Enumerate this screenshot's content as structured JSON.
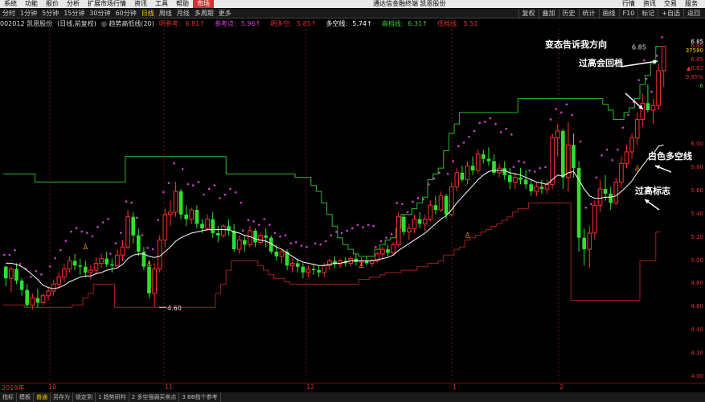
{
  "menu": {
    "items": [
      "系统",
      "功能",
      "报价",
      "分析",
      "扩展市场行情",
      "资讯",
      "工具",
      "帮助",
      "市场"
    ],
    "app_title": "通达信金融终端 凯恩股份",
    "right_items": [
      "行情",
      "资讯",
      "交易",
      "服务"
    ]
  },
  "toolbar": {
    "periods": [
      "分时",
      "1分钟",
      "5分钟",
      "15分钟",
      "30分钟",
      "60分钟",
      "日线",
      "周线",
      "月线",
      "多周期",
      "更多"
    ],
    "right_items": [
      "复权",
      "叠加",
      "历史",
      "统计",
      "画线",
      "F10",
      "标记",
      "+自选",
      "返回"
    ]
  },
  "legend": {
    "code_name": "002012 凯恩股份",
    "mode": "(日线,前复权)",
    "indicator": "◎ 趋势高低线(20)",
    "items": [
      {
        "label": "明参考:",
        "value": "6.81↑",
        "color": "#e03030"
      },
      {
        "label": "参考点:",
        "value": "5.96↑",
        "color": "#e040e0"
      },
      {
        "label": "明多空:",
        "value": "5.85↑",
        "color": "#e03030"
      },
      {
        "label": "多空线:",
        "value": "5.74↑",
        "color": "#ffffff"
      },
      {
        "label": "高档线:",
        "value": "6.31↑",
        "color": "#32cd32"
      },
      {
        "label": "低档线:",
        "value": "5.51",
        "color": "#e03030"
      }
    ]
  },
  "right_axis": {
    "price_ticks": [
      "6.85",
      "6.00",
      "5.80",
      "5.60",
      "5.40",
      "5.20",
      "5.00",
      "4.80",
      "4.60",
      "4.40",
      "4.20",
      "4.00"
    ],
    "info": [
      {
        "text": "6.85",
        "color": "#ffffff"
      },
      {
        "text": "37580",
        "color": "#ffd200"
      },
      {
        "text": "6.85",
        "color": "#e03030"
      },
      {
        "text": "▲0.62",
        "color": "#e03030"
      },
      {
        "text": "9.95%",
        "color": "#e03030"
      },
      {
        "text": "6",
        "color": "#32cd32"
      }
    ]
  },
  "time_axis": {
    "labels": [
      "2019年",
      "10",
      "11",
      "12",
      "1",
      "2"
    ]
  },
  "chart_labels": {
    "low_label": "4.60",
    "high_label": "6.85"
  },
  "annotations": {
    "a1": "变态告诉我方向",
    "a2": "过高会回档",
    "a3": "白色多空线",
    "a4": "过高标志"
  },
  "bottom_bar": {
    "items": [
      "指标",
      "模板",
      "普通",
      "另存为",
      "锁定到",
      "1 趋势研判",
      "2 多空强弱买卖点",
      "3 BB指个参考"
    ]
  },
  "chart_data": {
    "type": "candlestick",
    "ylim": [
      3.95,
      7.0
    ],
    "candles": [
      [
        4.95,
        4.96,
        4.78,
        4.85
      ],
      [
        4.85,
        4.95,
        4.73,
        4.93
      ],
      [
        4.93,
        4.98,
        4.8,
        4.83
      ],
      [
        4.83,
        4.85,
        4.7,
        4.75
      ],
      [
        4.75,
        4.8,
        4.6,
        4.62
      ],
      [
        4.62,
        4.72,
        4.58,
        4.68
      ],
      [
        4.68,
        4.76,
        4.6,
        4.64
      ],
      [
        4.64,
        4.72,
        4.62,
        4.7
      ],
      [
        4.7,
        4.78,
        4.66,
        4.74
      ],
      [
        4.74,
        4.84,
        4.7,
        4.8
      ],
      [
        4.8,
        4.9,
        4.76,
        4.86
      ],
      [
        4.86,
        4.97,
        4.82,
        4.93
      ],
      [
        4.93,
        5.04,
        4.9,
        5.0
      ],
      [
        5.0,
        5.06,
        4.92,
        4.96
      ],
      [
        4.96,
        5.02,
        4.88,
        4.95
      ],
      [
        4.95,
        5.0,
        4.86,
        4.9
      ],
      [
        4.9,
        4.96,
        4.84,
        4.92
      ],
      [
        4.92,
        5.03,
        4.88,
        4.98
      ],
      [
        4.98,
        5.06,
        4.94,
        5.02
      ],
      [
        5.02,
        5.08,
        4.95,
        4.97
      ],
      [
        4.97,
        5.02,
        4.9,
        4.96
      ],
      [
        4.96,
        5.1,
        4.94,
        5.05
      ],
      [
        5.05,
        5.18,
        5.0,
        5.12
      ],
      [
        5.12,
        5.44,
        5.1,
        5.38
      ],
      [
        5.38,
        5.42,
        5.15,
        5.22
      ],
      [
        5.22,
        5.28,
        5.04,
        5.08
      ],
      [
        5.08,
        5.12,
        4.92,
        4.95
      ],
      [
        4.95,
        5.0,
        4.68,
        4.72
      ],
      [
        4.72,
        4.98,
        4.6,
        4.93
      ],
      [
        4.93,
        5.22,
        4.9,
        5.18
      ],
      [
        5.18,
        5.45,
        5.12,
        5.4
      ],
      [
        5.4,
        5.52,
        5.3,
        5.42
      ],
      [
        5.42,
        5.68,
        5.38,
        5.6
      ],
      [
        5.6,
        5.62,
        5.36,
        5.4
      ],
      [
        5.4,
        5.48,
        5.3,
        5.36
      ],
      [
        5.36,
        5.46,
        5.32,
        5.44
      ],
      [
        5.44,
        5.48,
        5.28,
        5.32
      ],
      [
        5.32,
        5.36,
        5.24,
        5.28
      ],
      [
        5.28,
        5.4,
        5.26,
        5.36
      ],
      [
        5.36,
        5.42,
        5.2,
        5.24
      ],
      [
        5.24,
        5.3,
        5.16,
        5.22
      ],
      [
        5.22,
        5.32,
        5.2,
        5.3
      ],
      [
        5.3,
        5.36,
        5.22,
        5.26
      ],
      [
        5.26,
        5.32,
        5.08,
        5.1
      ],
      [
        5.1,
        5.22,
        5.06,
        5.18
      ],
      [
        5.18,
        5.22,
        5.08,
        5.14
      ],
      [
        5.14,
        5.3,
        5.12,
        5.26
      ],
      [
        5.26,
        5.28,
        5.12,
        5.16
      ],
      [
        5.16,
        5.24,
        5.14,
        5.22
      ],
      [
        5.22,
        5.28,
        5.12,
        5.2
      ],
      [
        5.2,
        5.22,
        5.06,
        5.08
      ],
      [
        5.08,
        5.14,
        5.0,
        5.04
      ],
      [
        5.04,
        5.1,
        4.98,
        5.08
      ],
      [
        5.08,
        5.1,
        4.92,
        4.96
      ],
      [
        4.96,
        5.02,
        4.9,
        4.98
      ],
      [
        4.98,
        5.02,
        4.9,
        4.95
      ],
      [
        4.95,
        4.98,
        4.85,
        4.9
      ],
      [
        4.9,
        4.96,
        4.86,
        4.93
      ],
      [
        4.93,
        4.98,
        4.88,
        4.92
      ],
      [
        4.92,
        4.96,
        4.86,
        4.9
      ],
      [
        4.9,
        4.98,
        4.86,
        4.96
      ],
      [
        4.96,
        5.02,
        4.92,
        5.0
      ],
      [
        5.0,
        5.04,
        4.94,
        4.97
      ],
      [
        4.97,
        5.02,
        4.94,
        5.0
      ],
      [
        5.0,
        5.03,
        4.95,
        4.98
      ],
      [
        4.98,
        5.04,
        4.95,
        5.02
      ],
      [
        5.02,
        5.06,
        4.96,
        4.99
      ],
      [
        4.99,
        5.03,
        4.95,
        5.0
      ],
      [
        5.0,
        5.04,
        4.96,
        4.98
      ],
      [
        4.98,
        5.02,
        4.95,
        5.0
      ],
      [
        5.0,
        5.08,
        4.98,
        5.06
      ],
      [
        5.06,
        5.12,
        5.02,
        5.1
      ],
      [
        5.1,
        5.14,
        5.04,
        5.07
      ],
      [
        5.07,
        5.16,
        5.05,
        5.14
      ],
      [
        5.14,
        5.42,
        5.12,
        5.38
      ],
      [
        5.38,
        5.4,
        5.22,
        5.25
      ],
      [
        5.25,
        5.32,
        5.18,
        5.28
      ],
      [
        5.28,
        5.4,
        5.24,
        5.36
      ],
      [
        5.36,
        5.42,
        5.28,
        5.32
      ],
      [
        5.32,
        5.4,
        5.26,
        5.36
      ],
      [
        5.36,
        5.52,
        5.34,
        5.48
      ],
      [
        5.48,
        5.56,
        5.4,
        5.44
      ],
      [
        5.44,
        5.6,
        5.42,
        5.56
      ],
      [
        5.56,
        5.58,
        5.36,
        5.4
      ],
      [
        5.4,
        5.68,
        5.38,
        5.64
      ],
      [
        5.64,
        5.8,
        5.6,
        5.76
      ],
      [
        5.76,
        5.82,
        5.68,
        5.7
      ],
      [
        5.7,
        5.86,
        5.66,
        5.82
      ],
      [
        5.82,
        5.9,
        5.74,
        5.78
      ],
      [
        5.78,
        5.96,
        5.76,
        5.92
      ],
      [
        5.92,
        5.96,
        5.84,
        5.88
      ],
      [
        5.88,
        5.98,
        5.82,
        5.86
      ],
      [
        5.86,
        5.92,
        5.74,
        5.76
      ],
      [
        5.76,
        5.84,
        5.72,
        5.8
      ],
      [
        5.8,
        5.86,
        5.7,
        5.74
      ],
      [
        5.74,
        5.8,
        5.62,
        5.68
      ],
      [
        5.68,
        5.76,
        5.62,
        5.72
      ],
      [
        5.72,
        5.8,
        5.66,
        5.7
      ],
      [
        5.7,
        5.78,
        5.62,
        5.66
      ],
      [
        5.66,
        5.7,
        5.56,
        5.6
      ],
      [
        5.6,
        5.68,
        5.56,
        5.64
      ],
      [
        5.64,
        5.7,
        5.58,
        5.62
      ],
      [
        5.62,
        5.7,
        5.58,
        5.66
      ],
      [
        5.66,
        6.1,
        5.62,
        6.06
      ],
      [
        6.06,
        6.18,
        5.9,
        6.12
      ],
      [
        6.12,
        6.14,
        5.62,
        5.72
      ],
      [
        5.72,
        6.2,
        5.6,
        6.0
      ],
      [
        6.0,
        6.1,
        5.72,
        5.8
      ],
      [
        5.8,
        5.86,
        5.08,
        5.2
      ],
      [
        5.2,
        5.28,
        4.96,
        5.1
      ],
      [
        5.1,
        5.3,
        4.94,
        5.24
      ],
      [
        5.24,
        5.52,
        5.18,
        5.48
      ],
      [
        5.48,
        5.7,
        5.42,
        5.62
      ],
      [
        5.62,
        5.74,
        5.52,
        5.58
      ],
      [
        5.58,
        5.64,
        5.44,
        5.5
      ],
      [
        5.5,
        5.72,
        5.48,
        5.68
      ],
      [
        5.68,
        5.9,
        5.64,
        5.84
      ],
      [
        5.84,
        6.0,
        5.8,
        5.94
      ],
      [
        5.94,
        6.1,
        5.88,
        6.06
      ],
      [
        6.06,
        6.28,
        6.0,
        6.22
      ],
      [
        6.22,
        6.44,
        6.16,
        6.36
      ],
      [
        6.36,
        6.52,
        6.28,
        6.3
      ],
      [
        6.3,
        6.4,
        6.18,
        6.34
      ],
      [
        6.34,
        6.7,
        6.3,
        6.64
      ],
      [
        6.64,
        6.85,
        6.5,
        6.85
      ]
    ],
    "multiline_white": [
      4.98,
      4.98,
      4.97,
      4.95,
      4.92,
      4.88,
      4.84,
      4.79,
      4.77,
      4.76,
      4.77,
      4.79,
      4.82,
      4.84,
      4.86,
      4.87,
      4.87,
      4.89,
      4.9,
      4.92,
      4.93,
      4.94,
      4.97,
      5.02,
      5.05,
      5.06,
      5.06,
      5.04,
      5.03,
      5.04,
      5.08,
      5.12,
      5.17,
      5.2,
      5.22,
      5.24,
      5.25,
      5.26,
      5.27,
      5.27,
      5.27,
      5.27,
      5.27,
      5.25,
      5.24,
      5.22,
      5.21,
      5.19,
      5.18,
      5.17,
      5.15,
      5.12,
      5.1,
      5.07,
      5.04,
      5.01,
      4.99,
      4.98,
      4.97,
      4.96,
      4.96,
      4.97,
      4.98,
      4.98,
      4.99,
      5.0,
      5.0,
      5.0,
      5.0,
      5.0,
      5.01,
      5.02,
      5.03,
      5.05,
      5.09,
      5.12,
      5.15,
      5.18,
      5.21,
      5.24,
      5.28,
      5.32,
      5.36,
      5.39,
      5.44,
      5.5,
      5.55,
      5.6,
      5.65,
      5.7,
      5.74,
      5.77,
      5.78,
      5.78,
      5.78,
      5.76,
      5.75,
      5.74,
      5.72,
      5.7,
      5.68,
      5.67,
      5.66,
      5.7,
      5.74,
      5.73,
      5.76,
      5.77,
      5.7,
      5.62,
      5.56,
      5.54,
      5.54,
      5.55,
      5.55,
      5.56,
      5.6,
      5.64,
      5.69,
      5.76,
      5.82,
      5.88,
      5.92,
      5.99,
      6.0
    ],
    "band_high_green": [
      5.75,
      5.75,
      5.75,
      5.75,
      5.75,
      5.75,
      5.68,
      5.68,
      5.68,
      5.68,
      5.68,
      5.68,
      5.68,
      5.68,
      5.68,
      5.68,
      5.68,
      5.68,
      5.68,
      5.68,
      5.68,
      5.68,
      5.68,
      5.9,
      5.9,
      5.9,
      5.9,
      5.9,
      5.9,
      5.9,
      5.9,
      5.9,
      5.9,
      5.9,
      5.9,
      5.9,
      5.9,
      5.9,
      5.9,
      5.9,
      5.9,
      5.9,
      5.75,
      5.75,
      5.75,
      5.75,
      5.75,
      5.75,
      5.75,
      5.75,
      5.75,
      5.75,
      5.75,
      5.75,
      5.75,
      5.72,
      5.72,
      5.72,
      5.65,
      5.6,
      5.5,
      5.4,
      5.3,
      5.2,
      5.14,
      5.1,
      5.06,
      5.04,
      5.04,
      5.04,
      5.1,
      5.14,
      5.18,
      5.2,
      5.28,
      5.4,
      5.4,
      5.45,
      5.5,
      5.55,
      5.7,
      5.75,
      5.8,
      5.95,
      6.1,
      6.18,
      6.28,
      6.28,
      6.28,
      6.28,
      6.28,
      6.28,
      6.28,
      6.28,
      6.28,
      6.28,
      6.28,
      6.4,
      6.4,
      6.4,
      6.4,
      6.4,
      6.4,
      6.4,
      6.4,
      6.4,
      6.4,
      6.4,
      6.4,
      6.4,
      6.4,
      6.4,
      6.4,
      6.35,
      6.3,
      6.22,
      6.22,
      6.28,
      6.32,
      6.4,
      6.52,
      6.6,
      6.7,
      6.85
    ],
    "band_low_red": [
      4.62,
      4.62,
      4.62,
      4.62,
      4.6,
      4.6,
      4.6,
      4.6,
      4.6,
      4.6,
      4.6,
      4.6,
      4.6,
      4.62,
      4.62,
      4.68,
      4.72,
      4.8,
      4.8,
      4.8,
      4.8,
      4.6,
      4.6,
      4.6,
      4.6,
      4.6,
      4.6,
      4.6,
      4.6,
      4.6,
      4.6,
      4.6,
      4.6,
      4.6,
      4.6,
      4.6,
      4.6,
      4.6,
      4.6,
      4.6,
      4.72,
      4.8,
      4.92,
      5.0,
      5.0,
      5.0,
      5.0,
      5.0,
      4.96,
      4.92,
      4.88,
      4.85,
      4.85,
      4.82,
      4.8,
      4.8,
      4.8,
      4.8,
      4.8,
      4.8,
      4.8,
      4.8,
      4.8,
      4.8,
      4.8,
      4.8,
      4.8,
      4.84,
      4.84,
      4.86,
      4.86,
      4.88,
      4.9,
      4.9,
      4.9,
      4.92,
      4.92,
      4.92,
      4.95,
      4.95,
      4.98,
      4.98,
      5.0,
      5.05,
      5.05,
      5.1,
      5.12,
      5.18,
      5.2,
      5.22,
      5.25,
      5.27,
      5.3,
      5.32,
      5.35,
      5.38,
      5.42,
      5.45,
      5.45,
      5.5,
      5.5,
      5.5,
      5.5,
      5.5,
      5.5,
      5.5,
      5.5,
      4.66,
      4.66,
      4.66,
      4.66,
      4.66,
      4.66,
      4.66,
      4.66,
      4.66,
      4.66,
      4.66,
      4.66,
      4.66,
      5.0,
      5.0,
      5.0,
      5.25
    ]
  }
}
